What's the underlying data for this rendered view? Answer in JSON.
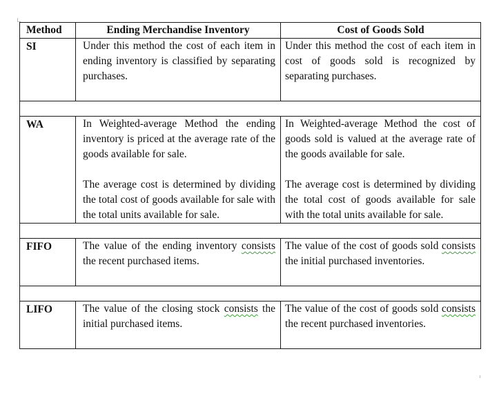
{
  "headers": {
    "method": "Method",
    "ending": "Ending Merchandise Inventory",
    "cogs": "Cost of Goods Sold"
  },
  "rows": {
    "si": {
      "method": "SI",
      "ending": "Under this method the cost of each item in ending inventory is classified by separating purchases.",
      "cogs": "Under this method the cost of each item in cost of goods sold is recognized by separating purchases."
    },
    "wa": {
      "method": "WA",
      "ending_p1": "In Weighted-average Method the ending inventory is priced at the average rate of the goods available for sale.",
      "ending_p2": "The average cost is determined by dividing the total cost of goods available for sale with the total units available for sale.",
      "cogs_p1": "In Weighted-average Method the cost of goods sold is valued at the average rate of the goods available for sale.",
      "cogs_p2": "The average cost is determined by dividing the total cost of goods available for sale with the total units available for sale."
    },
    "fifo": {
      "method": "FIFO",
      "ending_first_word": "consists",
      "ending_a": "The value of the ending inventory",
      "ending_b": " the recent purchased items.",
      "cogs_a": "The value of the cost of goods sold",
      "cogs_first_word": "consists",
      "cogs_b": " the initial purchased inventories."
    },
    "lifo": {
      "method": "LIFO",
      "ending_a": "The value of the closing stock",
      "ending_first_word": "consists",
      "ending_b": " the initial purchased items.",
      "cogs_a": "The value of the cost of goods sold",
      "cogs_first_word": "consists",
      "cogs_b": " the recent purchased inventories."
    }
  }
}
